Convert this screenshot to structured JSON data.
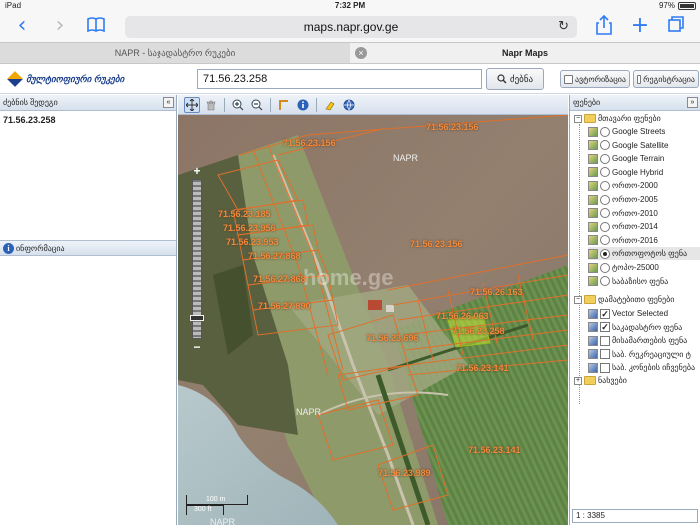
{
  "status_bar": {
    "device": "iPad",
    "time": "7:32 PM",
    "battery": "97%"
  },
  "browser": {
    "url": "maps.napr.gov.ge",
    "tabs": [
      {
        "label": "NAPR - საჯადასტრო რუკები"
      },
      {
        "label": "Napr Maps"
      }
    ]
  },
  "header": {
    "logo_text": "მულტიოფიური რუკები",
    "search_value": "71.56.23.258",
    "search_button": "ძებნა",
    "auth_button": "ავტორიზაცია",
    "register_button": "რეგისტრაცია"
  },
  "left_panel": {
    "title": "ძებნის შედეგი",
    "result": "71.56.23.258",
    "info_title": "ინფორმაცია"
  },
  "map": {
    "watermark": "home.ge",
    "region_labels": [
      "NAPR",
      "NAPR",
      "NAPR"
    ],
    "parcel_labels": [
      "71.56.23.156",
      "71.56.23.156",
      "71.56.23.185",
      "71.56.23.956",
      "71.56.23.953",
      "71.56.23.156",
      "71.56.27.868",
      "71.56.27.868",
      "71.56.27.890",
      "71.56.26.163",
      "71.56.26.063",
      "71.56.23.696",
      "71.56.23.258",
      "71.56.23.141",
      "71.56.23.141",
      "71.56.23.989"
    ],
    "scale_m": "100 m",
    "scale_ft": "300 ft"
  },
  "right_panel": {
    "title": "ფენები",
    "groups": {
      "base": "მთავარი ფენები",
      "overlay": "დამატებითი ფენები",
      "maps": "ნახვები"
    },
    "base_layers": [
      {
        "label": "Google Streets",
        "on": false
      },
      {
        "label": "Google Satellite",
        "on": false
      },
      {
        "label": "Google Terrain",
        "on": false
      },
      {
        "label": "Google Hybrid",
        "on": false
      },
      {
        "label": "ორთო-2000",
        "on": false
      },
      {
        "label": "ორთო-2005",
        "on": false
      },
      {
        "label": "ორთო-2010",
        "on": false
      },
      {
        "label": "ორთო-2014",
        "on": false
      },
      {
        "label": "ორთო-2016",
        "on": false
      },
      {
        "label": "ორთოფოტოს ფენა",
        "on": true
      },
      {
        "label": "ტოპო-25000",
        "on": false
      },
      {
        "label": "საბაზისო ფენა",
        "on": false
      }
    ],
    "overlay_layers": [
      {
        "label": "Vector Selected",
        "checked": true
      },
      {
        "label": "საკადასტრო ფენა",
        "checked": true
      },
      {
        "label": "მისამართების ფენა",
        "checked": false
      },
      {
        "label": "საბ. რეკრეაციული ტ",
        "checked": false
      },
      {
        "label": "საბ. კონების იჩვენება",
        "checked": false
      }
    ],
    "scale": "1 : 3385"
  },
  "colors": {
    "parcel_line": "#e0702a",
    "parcel_label": "#f08a3c",
    "selected_parcel": "#c8e83a",
    "accent_blue": "#2f7cf6"
  }
}
